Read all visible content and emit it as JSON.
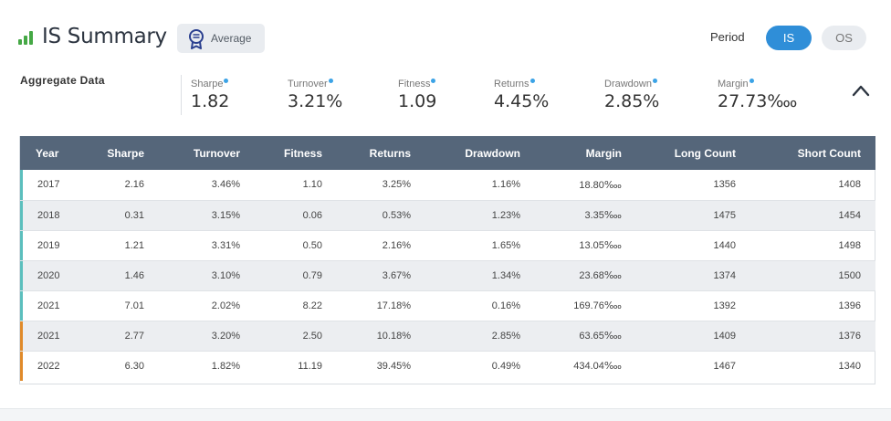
{
  "header": {
    "title": "IS Summary",
    "badge_label": "Average",
    "period_label": "Period",
    "period_options": [
      "IS",
      "OS"
    ],
    "period_selected": "IS"
  },
  "aggregate": {
    "label": "Aggregate Data",
    "metrics": [
      {
        "label": "Sharpe",
        "value": "1.82"
      },
      {
        "label": "Turnover",
        "value": "3.21%"
      },
      {
        "label": "Fitness",
        "value": "1.09"
      },
      {
        "label": "Returns",
        "value": "4.45%"
      },
      {
        "label": "Drawdown",
        "value": "2.85%"
      },
      {
        "label": "Margin",
        "value": "27.73‱"
      }
    ]
  },
  "table": {
    "columns": [
      "Year",
      "Sharpe",
      "Turnover",
      "Fitness",
      "Returns",
      "Drawdown",
      "Margin",
      "Long Count",
      "Short Count"
    ],
    "rows": [
      {
        "period": "IS",
        "cells": [
          "2017",
          "2.16",
          "3.46%",
          "1.10",
          "3.25%",
          "1.16%",
          "18.80‱",
          "1356",
          "1408"
        ]
      },
      {
        "period": "IS",
        "cells": [
          "2018",
          "0.31",
          "3.15%",
          "0.06",
          "0.53%",
          "1.23%",
          "3.35‱",
          "1475",
          "1454"
        ]
      },
      {
        "period": "IS",
        "cells": [
          "2019",
          "1.21",
          "3.31%",
          "0.50",
          "2.16%",
          "1.65%",
          "13.05‱",
          "1440",
          "1498"
        ]
      },
      {
        "period": "IS",
        "cells": [
          "2020",
          "1.46",
          "3.10%",
          "0.79",
          "3.67%",
          "1.34%",
          "23.68‱",
          "1374",
          "1500"
        ]
      },
      {
        "period": "IS",
        "cells": [
          "2021",
          "7.01",
          "2.02%",
          "8.22",
          "17.18%",
          "0.16%",
          "169.76‱",
          "1392",
          "1396"
        ]
      },
      {
        "period": "OS",
        "cells": [
          "2021",
          "2.77",
          "3.20%",
          "2.50",
          "10.18%",
          "2.85%",
          "63.65‱",
          "1409",
          "1376"
        ]
      },
      {
        "period": "OS",
        "cells": [
          "2022",
          "6.30",
          "1.82%",
          "11.19",
          "39.45%",
          "0.49%",
          "434.04‱",
          "1467",
          "1340"
        ]
      }
    ]
  },
  "colors": {
    "accent": "#2f8ed8",
    "signal_green": "#45a845",
    "header_bg": "#55667a",
    "is_bar": "#5bbfbd",
    "os_bar": "#e08a2a"
  },
  "icons": {
    "title": "signal-bars-icon",
    "badge": "ribbon-award-icon",
    "collapse": "chevron-up-icon"
  }
}
